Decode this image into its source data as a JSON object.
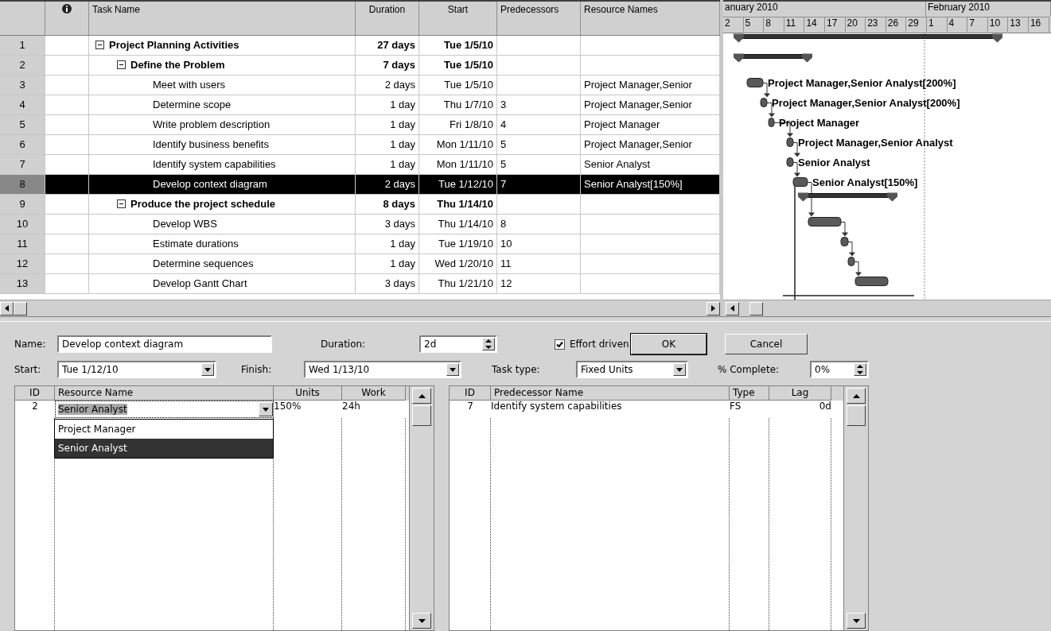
{
  "task_table": {
    "columns": [
      "Task Name",
      "Duration",
      "Start",
      "Predecessors",
      "Resource Names"
    ],
    "rows": [
      {
        "id": "1",
        "name": "Project Planning Activities",
        "kind": "summary",
        "expanded": true,
        "selected": false,
        "duration": "27 days",
        "start": "Tue 1/5/10",
        "children": [
          {
            "id": "2",
            "name": "Define the Problem",
            "kind": "summary",
            "expanded": true,
            "selected": false,
            "duration": "7 days",
            "start": "Tue 1/5/10",
            "children": [
              {
                "id": "3",
                "name": "Meet with users",
                "kind": "task",
                "selected": false,
                "duration": "2 days",
                "start": "Tue 1/5/10",
                "resources": "Project Manager,Senior",
                "gantt_label": "Project Manager,Senior Analyst[200%]"
              },
              {
                "id": "4",
                "name": "Determine scope",
                "kind": "task",
                "selected": false,
                "duration": "1 day",
                "start": "Thu 1/7/10",
                "predecessors": "3",
                "resources": "Project Manager,Senior",
                "gantt_label": "Project Manager,Senior Analyst[200%]"
              },
              {
                "id": "5",
                "name": "Write problem description",
                "kind": "task",
                "selected": false,
                "duration": "1 day",
                "start": "Fri 1/8/10",
                "predecessors": "4",
                "resources": "Project Manager",
                "gantt_label": "Project Manager"
              },
              {
                "id": "6",
                "name": "Identify business benefits",
                "kind": "task",
                "selected": false,
                "duration": "1 day",
                "start": "Mon 1/11/10",
                "predecessors": "5",
                "resources": "Project Manager,Senior",
                "gantt_label": "Project Manager,Senior Analyst"
              },
              {
                "id": "7",
                "name": "Identify system capabilities",
                "kind": "task",
                "selected": false,
                "duration": "1 day",
                "start": "Mon 1/11/10",
                "predecessors": "5",
                "resources": "Senior Analyst",
                "gantt_label": "Senior Analyst"
              },
              {
                "id": "8",
                "name": "Develop context diagram",
                "kind": "task",
                "selected": true,
                "duration": "2 days",
                "start": "Tue 1/12/10",
                "predecessors": "7",
                "resources": "Senior Analyst[150%]",
                "gantt_label": "Senior Analyst[150%]"
              }
            ]
          },
          {
            "id": "9",
            "name": "Produce the project schedule",
            "kind": "summary",
            "expanded": true,
            "selected": false,
            "duration": "8 days",
            "start": "Thu 1/14/10",
            "children": [
              {
                "id": "10",
                "name": "Develop WBS",
                "kind": "task",
                "selected": false,
                "duration": "3 days",
                "start": "Thu 1/14/10",
                "predecessors": "8"
              },
              {
                "id": "11",
                "name": "Estimate durations",
                "kind": "task",
                "selected": false,
                "duration": "1 day",
                "start": "Tue 1/19/10",
                "predecessors": "10"
              },
              {
                "id": "12",
                "name": "Determine sequences",
                "kind": "task",
                "selected": false,
                "duration": "1 day",
                "start": "Wed 1/20/10",
                "predecessors": "11"
              },
              {
                "id": "13",
                "name": "Develop Gantt Chart",
                "kind": "task",
                "selected": false,
                "duration": "3 days",
                "start": "Thu 1/21/10",
                "predecessors": "12"
              }
            ]
          }
        ]
      }
    ]
  },
  "gantt": {
    "months": [
      "anuary 2010",
      "February 2010"
    ],
    "days": [
      "2",
      "5",
      "8",
      "11",
      "14",
      "17",
      "20",
      "23",
      "26",
      "29",
      "1",
      "4",
      "7",
      "10",
      "13",
      "16"
    ]
  },
  "task_form": {
    "name_label": "Name:",
    "name": "Develop context diagram",
    "duration_label": "Duration:",
    "duration": "2d",
    "effort_driven": {
      "label": "Effort driven",
      "checked": true
    },
    "ok": "OK",
    "cancel": "Cancel",
    "start_label": "Start:",
    "start": "Tue 1/12/10",
    "finish_label": "Finish:",
    "finish": "Wed 1/13/10",
    "task_type_label": "Task type:",
    "task_type": "Fixed Units",
    "complete_label": "% Complete:",
    "complete": "0%",
    "resources": {
      "columns": [
        "ID",
        "Resource Name",
        "Units",
        "Work"
      ],
      "rows": [
        {
          "id": "2",
          "name": "Senior Analyst",
          "units": "150%",
          "work": "24h",
          "editing": true
        }
      ],
      "dropdown": [
        {
          "label": "Project Manager",
          "selected": false
        },
        {
          "label": "Senior Analyst",
          "selected": true
        }
      ]
    },
    "predecessors": {
      "columns": [
        "ID",
        "Predecessor Name",
        "Type",
        "Lag"
      ],
      "rows": [
        {
          "id": "7",
          "name": "Identify system capabilities",
          "type": "FS",
          "lag": "0d"
        }
      ]
    }
  }
}
